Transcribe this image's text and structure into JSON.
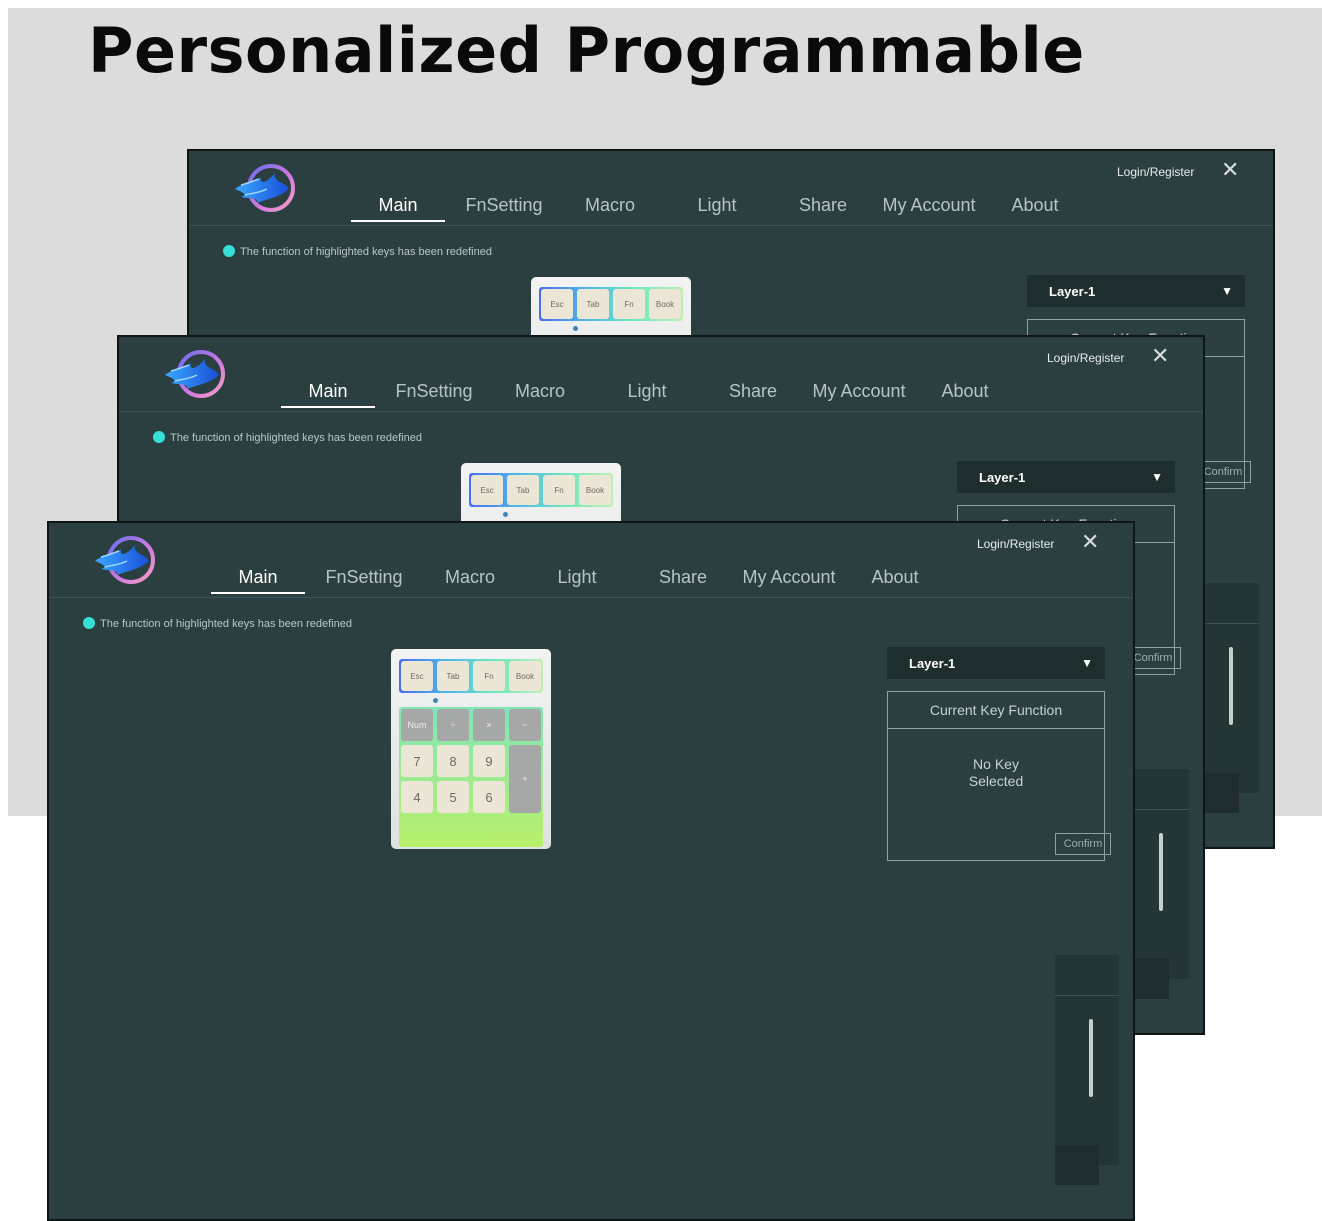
{
  "headline": "Personalized Programmable",
  "window": {
    "login_label": "Login/Register",
    "close_glyph": "✕",
    "nav": [
      "Main",
      "FnSetting",
      "Macro",
      "Light",
      "Share",
      "My Account",
      "About"
    ],
    "active_nav": "Main",
    "info_text": "The function of highlighted keys has been redefined",
    "layer_label": "Layer-1",
    "layer_arrow": "▼",
    "current_key_function": "Current Key Function",
    "no_key_line1": "No Key",
    "no_key_line2": "Selected",
    "confirm_label": "Confirm",
    "top_keys": [
      "Esc",
      "Tab",
      "Fn",
      "Book"
    ],
    "numpad_keys": [
      "Num",
      "÷",
      "×",
      "−",
      "7",
      "8",
      "9",
      "+",
      "4",
      "5",
      "6"
    ]
  },
  "colors": {
    "window_bg": "#2c3f40",
    "accent_dot": "#35e0d6",
    "layer_bg": "#1e2d2e"
  },
  "icons": {
    "logo": "flame-ring-logo-icon",
    "close": "close-icon",
    "dropdown": "triangle-down-icon"
  }
}
